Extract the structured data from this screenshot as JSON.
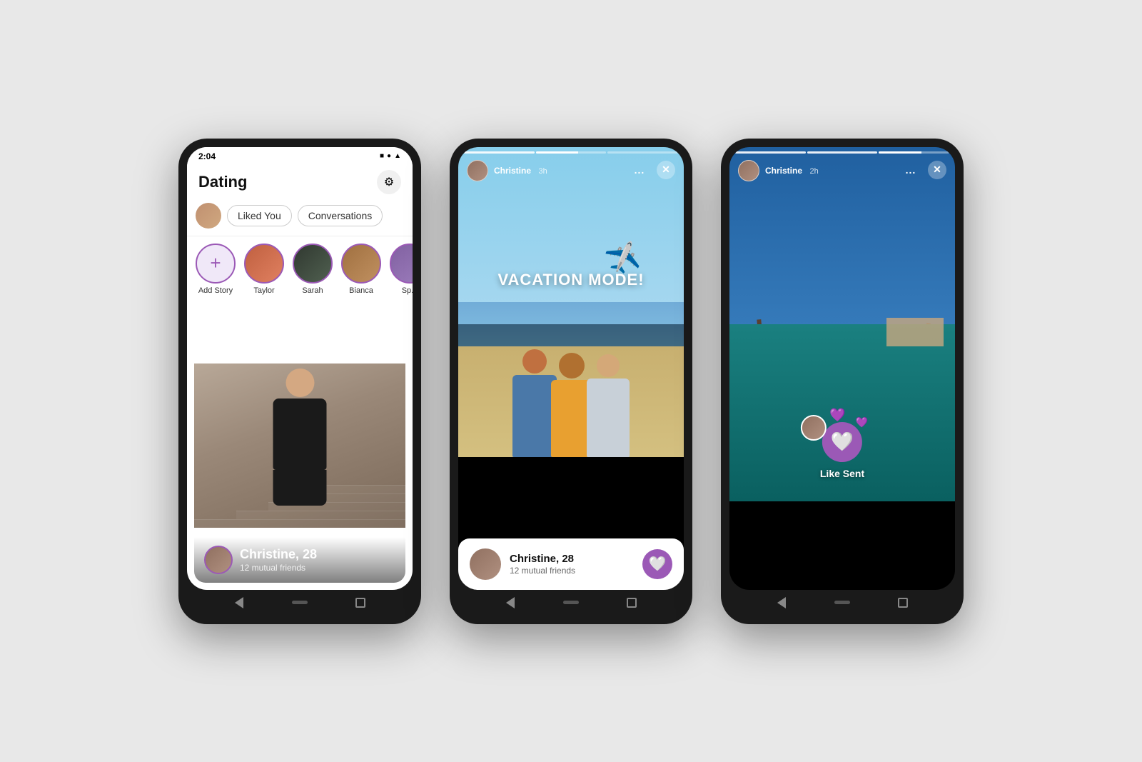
{
  "page": {
    "bg_color": "#e8e8e8"
  },
  "phone1": {
    "time": "2:04",
    "status_icons": [
      "■",
      "●",
      "▲"
    ],
    "header": {
      "title": "Dating",
      "settings_label": "⚙"
    },
    "tabs": {
      "liked_you": "Liked You",
      "conversations": "Conversations"
    },
    "stories": [
      {
        "label": "Add Story",
        "type": "add"
      },
      {
        "label": "Taylor",
        "type": "user"
      },
      {
        "label": "Sarah",
        "type": "user"
      },
      {
        "label": "Bianca",
        "type": "user"
      },
      {
        "label": "Sp...",
        "type": "user"
      }
    ],
    "profile": {
      "name": "Christine, 28",
      "mutual": "12 mutual friends"
    }
  },
  "phone2": {
    "time": "",
    "story_user": "Christine",
    "story_time": "3h",
    "vacation_text": "VACATION MODE!",
    "profile": {
      "name": "Christine, 28",
      "mutual": "12 mutual friends"
    },
    "actions": {
      "more": "...",
      "close": "✕"
    }
  },
  "phone3": {
    "story_user": "Christine",
    "story_time": "2h",
    "like_sent": "Like Sent",
    "actions": {
      "more": "...",
      "close": "✕"
    }
  }
}
